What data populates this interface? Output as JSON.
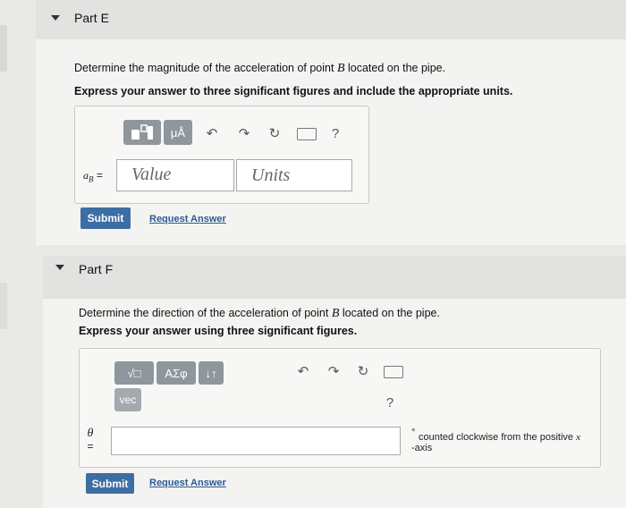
{
  "part_e": {
    "title": "Part E",
    "question_prefix": "Determine the magnitude of the acceleration of point ",
    "question_var": "B",
    "question_suffix": " located on the pipe.",
    "instruction": "Express your answer to three significant figures and include the appropriate units.",
    "toolbar": {
      "mu_a_label": "μÅ",
      "help_label": "?"
    },
    "answer_label_var": "a",
    "answer_label_sub": "B",
    "answer_label_eq": "=",
    "value_placeholder": "Value",
    "units_placeholder": "Units",
    "submit_label": "Submit",
    "request_label": "Request Answer"
  },
  "part_f": {
    "title": "Part F",
    "question_prefix": "Determine the direction of the acceleration of point ",
    "question_var": "B",
    "question_suffix": " located on the pipe.",
    "instruction": "Express your answer using three significant figures.",
    "toolbar": {
      "sqrt_label": "√□",
      "sigma_label": "ΑΣφ",
      "arrows_label": "↓↑",
      "vec_label": "vec",
      "help_label": "?"
    },
    "answer_label_var": "θ",
    "answer_label_eq": "=",
    "unit_degree": "°",
    "unit_text_prefix": "counted clockwise from the positive ",
    "unit_text_var": "x",
    "unit_text_suffix": "-axis",
    "submit_label": "Submit",
    "request_label": "Request Answer"
  },
  "colors": {
    "submit_bg": "#3d6ea3",
    "link": "#2c5b94",
    "toolbar_btn": "#8f969c"
  },
  "icons": [
    "caret-down-icon",
    "undo-icon",
    "redo-icon",
    "reset-icon",
    "keyboard-icon",
    "help-icon",
    "matrix-icon",
    "mu-a-icon",
    "sqrt-icon",
    "greek-icon",
    "arrows-icon",
    "vec-icon"
  ]
}
